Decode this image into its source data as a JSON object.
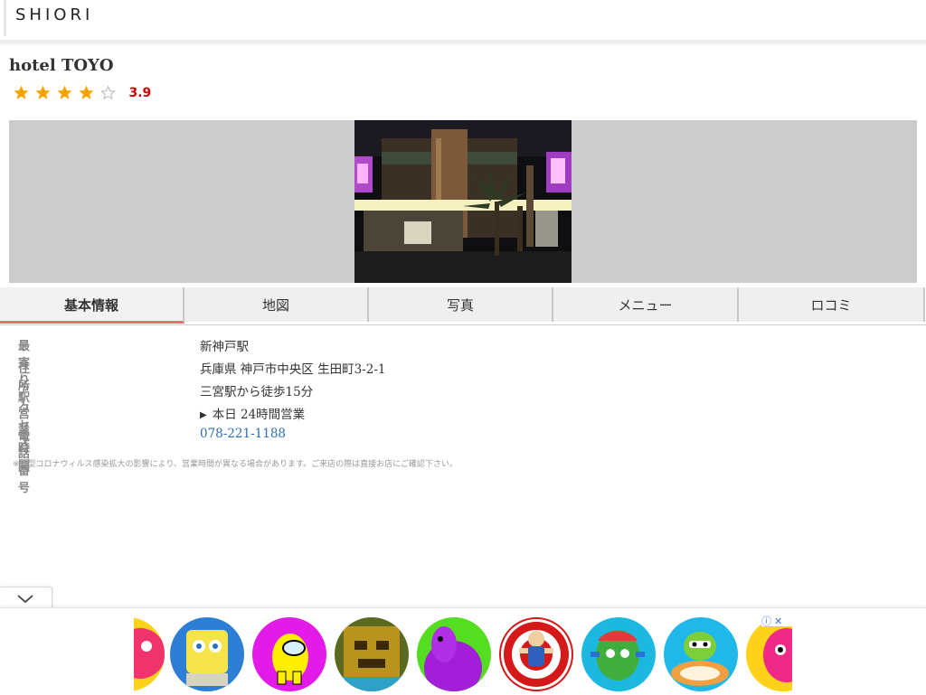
{
  "header": {
    "logo_text": "SHIORI"
  },
  "hotel": {
    "name": "hotel TOYO",
    "rating": 3.9,
    "rating_text": "3.9",
    "stars_filled": 4,
    "stars_total": 5
  },
  "colors": {
    "star_filled": "#f5a400",
    "star_empty": "#bdbdbd",
    "rating_text": "#cc0000",
    "tab_active_underline": "#e86d6d",
    "link": "#2a6fb8",
    "photo_bg": "#cccccc"
  },
  "tabs": [
    {
      "label": "基本情報",
      "active": true
    },
    {
      "label": "地図",
      "active": false
    },
    {
      "label": "写真",
      "active": false
    },
    {
      "label": "メニュー",
      "active": false
    },
    {
      "label": "ロコミ",
      "active": false
    }
  ],
  "info": {
    "station": {
      "label": "最寄り駅",
      "value": "新神戸駅"
    },
    "address": {
      "label": "住所",
      "value": "兵庫県 神戸市中央区 生田町3-2-1"
    },
    "access": {
      "label": "アクセス",
      "value": "三宮駅から徒歩15分"
    },
    "hours": {
      "label": "営業時間",
      "value": "本日 24時間営業"
    },
    "phone": {
      "label": "電話番号",
      "value": "078-221-1188"
    }
  },
  "notice": "※新型コロナウィルス感染拡大の影響により、営業時間が異なる場合があります。ご来店の際は直接お店にご確認下さい。",
  "ad": {
    "icons": [
      "info-icon",
      "close-icon"
    ],
    "items": [
      "pink-character",
      "sponge-character",
      "crewmate-character",
      "temple-game",
      "purple-blob-character",
      "dart-board-doll",
      "watermelon-character",
      "green-candy-monster",
      "pink-blob-character"
    ]
  }
}
